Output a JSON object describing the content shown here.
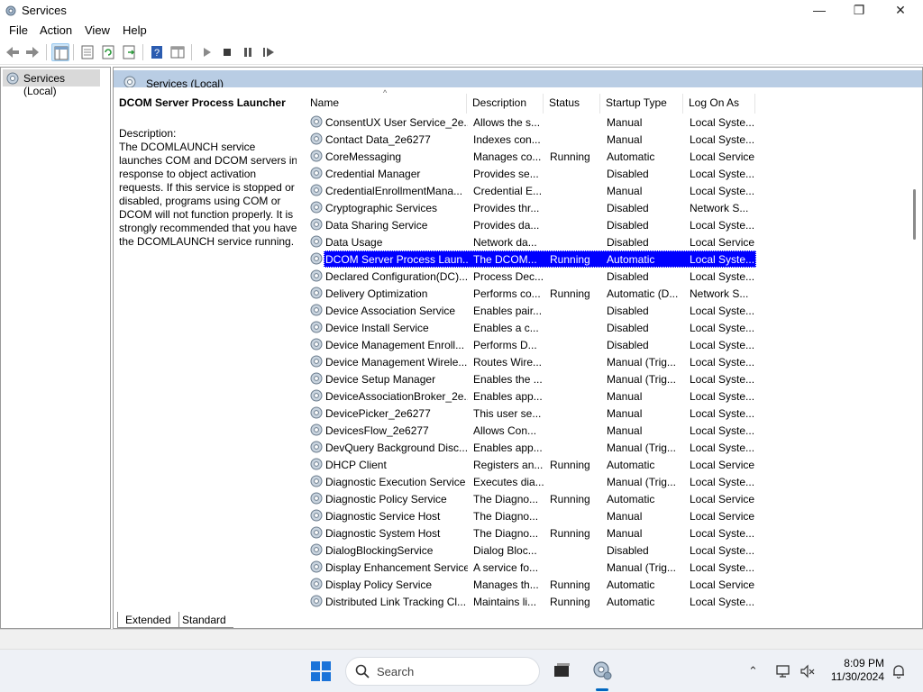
{
  "window": {
    "title": "Services"
  },
  "menu": [
    "File",
    "Action",
    "View",
    "Help"
  ],
  "tree": {
    "root_label": "Services (Local)"
  },
  "pane": {
    "header_label": "Services (Local)",
    "description": {
      "service_title": "DCOM Server Process Launcher",
      "label": "Description:",
      "text": "The DCOMLAUNCH service launches COM and DCOM servers in response to object activation requests. If this service is stopped or disabled, programs using COM or DCOM will not function properly. It is strongly recommended that you have the DCOMLAUNCH service running."
    },
    "columns": [
      "Name",
      "Description",
      "Status",
      "Startup Type",
      "Log On As"
    ],
    "selected_index": 8,
    "rows": [
      {
        "name": "ConsentUX User Service_2e...",
        "desc": "Allows the s...",
        "status": "",
        "startup": "Manual",
        "logon": "Local Syste..."
      },
      {
        "name": "Contact Data_2e6277",
        "desc": "Indexes con...",
        "status": "",
        "startup": "Manual",
        "logon": "Local Syste..."
      },
      {
        "name": "CoreMessaging",
        "desc": "Manages co...",
        "status": "Running",
        "startup": "Automatic",
        "logon": "Local Service"
      },
      {
        "name": "Credential Manager",
        "desc": "Provides se...",
        "status": "",
        "startup": "Disabled",
        "logon": "Local Syste..."
      },
      {
        "name": "CredentialEnrollmentMana...",
        "desc": "Credential E...",
        "status": "",
        "startup": "Manual",
        "logon": "Local Syste..."
      },
      {
        "name": "Cryptographic Services",
        "desc": "Provides thr...",
        "status": "",
        "startup": "Disabled",
        "logon": "Network S..."
      },
      {
        "name": "Data Sharing Service",
        "desc": "Provides da...",
        "status": "",
        "startup": "Disabled",
        "logon": "Local Syste..."
      },
      {
        "name": "Data Usage",
        "desc": "Network da...",
        "status": "",
        "startup": "Disabled",
        "logon": "Local Service"
      },
      {
        "name": "DCOM Server Process Laun...",
        "desc": "The DCOM...",
        "status": "Running",
        "startup": "Automatic",
        "logon": "Local Syste..."
      },
      {
        "name": "Declared Configuration(DC)...",
        "desc": "Process Dec...",
        "status": "",
        "startup": "Disabled",
        "logon": "Local Syste..."
      },
      {
        "name": "Delivery Optimization",
        "desc": "Performs co...",
        "status": "Running",
        "startup": "Automatic (D...",
        "logon": "Network S..."
      },
      {
        "name": "Device Association Service",
        "desc": "Enables pair...",
        "status": "",
        "startup": "Disabled",
        "logon": "Local Syste..."
      },
      {
        "name": "Device Install Service",
        "desc": "Enables a c...",
        "status": "",
        "startup": "Disabled",
        "logon": "Local Syste..."
      },
      {
        "name": "Device Management Enroll...",
        "desc": "Performs D...",
        "status": "",
        "startup": "Disabled",
        "logon": "Local Syste..."
      },
      {
        "name": "Device Management Wirele...",
        "desc": "Routes Wire...",
        "status": "",
        "startup": "Manual (Trig...",
        "logon": "Local Syste..."
      },
      {
        "name": "Device Setup Manager",
        "desc": "Enables the ...",
        "status": "",
        "startup": "Manual (Trig...",
        "logon": "Local Syste..."
      },
      {
        "name": "DeviceAssociationBroker_2e...",
        "desc": "Enables app...",
        "status": "",
        "startup": "Manual",
        "logon": "Local Syste..."
      },
      {
        "name": "DevicePicker_2e6277",
        "desc": "This user se...",
        "status": "",
        "startup": "Manual",
        "logon": "Local Syste..."
      },
      {
        "name": "DevicesFlow_2e6277",
        "desc": "Allows Con...",
        "status": "",
        "startup": "Manual",
        "logon": "Local Syste..."
      },
      {
        "name": "DevQuery Background Disc...",
        "desc": "Enables app...",
        "status": "",
        "startup": "Manual (Trig...",
        "logon": "Local Syste..."
      },
      {
        "name": "DHCP Client",
        "desc": "Registers an...",
        "status": "Running",
        "startup": "Automatic",
        "logon": "Local Service"
      },
      {
        "name": "Diagnostic Execution Service",
        "desc": "Executes dia...",
        "status": "",
        "startup": "Manual (Trig...",
        "logon": "Local Syste..."
      },
      {
        "name": "Diagnostic Policy Service",
        "desc": "The Diagno...",
        "status": "Running",
        "startup": "Automatic",
        "logon": "Local Service"
      },
      {
        "name": "Diagnostic Service Host",
        "desc": "The Diagno...",
        "status": "",
        "startup": "Manual",
        "logon": "Local Service"
      },
      {
        "name": "Diagnostic System Host",
        "desc": "The Diagno...",
        "status": "Running",
        "startup": "Manual",
        "logon": "Local Syste..."
      },
      {
        "name": "DialogBlockingService",
        "desc": "Dialog Bloc...",
        "status": "",
        "startup": "Disabled",
        "logon": "Local Syste..."
      },
      {
        "name": "Display Enhancement Service",
        "desc": "A service fo...",
        "status": "",
        "startup": "Manual (Trig...",
        "logon": "Local Syste..."
      },
      {
        "name": "Display Policy Service",
        "desc": "Manages th...",
        "status": "Running",
        "startup": "Automatic",
        "logon": "Local Service"
      },
      {
        "name": "Distributed Link Tracking Cl...",
        "desc": "Maintains li...",
        "status": "Running",
        "startup": "Automatic",
        "logon": "Local Syste..."
      }
    ],
    "tabs": [
      "Extended",
      "Standard"
    ],
    "active_tab": "Extended"
  },
  "taskbar": {
    "search_placeholder": "Search",
    "time": "8:09 PM",
    "date": "11/30/2024"
  },
  "icons": {
    "gear": "gear-icon",
    "selection_color": "#0000ff",
    "header_color": "#b9cde4"
  }
}
